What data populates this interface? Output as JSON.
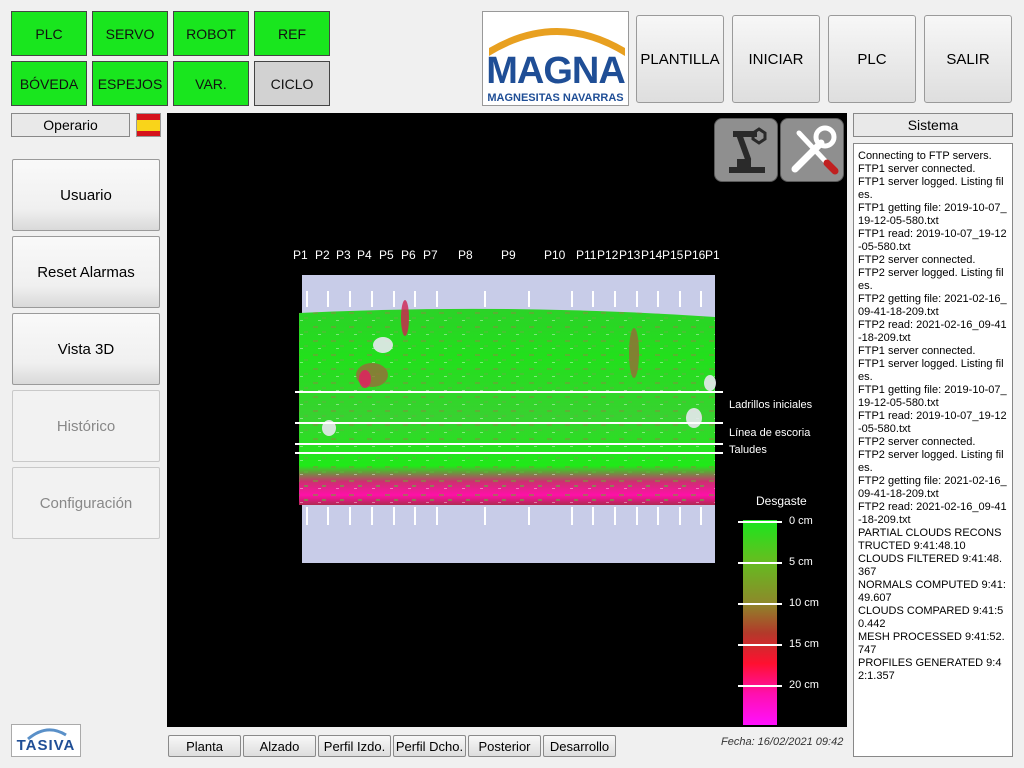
{
  "nav_buttons": {
    "plc": "PLC",
    "servo": "SERVO",
    "robot": "ROBOT",
    "ref": "REF",
    "boveda": "BÓVEDA",
    "espejos": "ESPEJOS",
    "var": "VAR.",
    "ciclo": "CICLO"
  },
  "logo": {
    "brand": "MAGNA",
    "subtitle": "MAGNESITAS NAVARRAS"
  },
  "top_buttons": {
    "plantilla": "PLANTILLA",
    "iniciar": "INICIAR",
    "plc": "PLC",
    "salir": "SALIR"
  },
  "user_label": "Operario",
  "sistema_label": "Sistema",
  "side_buttons": {
    "usuario": "Usuario",
    "reset_alarmas": "Reset Alarmas",
    "vista_3d": "Vista 3D",
    "historico": "Histórico",
    "configuracion": "Configuración"
  },
  "viewport": {
    "profiles": [
      "P1",
      "P2",
      "P3",
      "P4",
      "P5",
      "P6",
      "P7",
      "P8",
      "P9",
      "P10",
      "P11",
      "P12",
      "P13",
      "P14",
      "P15",
      "P16",
      "P1"
    ],
    "line_labels": {
      "ladrillos": "Ladrillos iniciales",
      "escoria": "Línea de escoria",
      "taludes": "Taludes"
    },
    "scale": {
      "title": "Desgaste",
      "ticks": [
        "0 cm",
        "5 cm",
        "10 cm",
        "15 cm",
        "20 cm"
      ]
    },
    "colors": {
      "good": "#19e61e",
      "mid": "#8c8a2a",
      "bad": "#ff1030",
      "worst": "#ff10ff"
    }
  },
  "log": [
    "Connecting to FTP servers.",
    "FTP1 server connected.",
    "FTP1 server logged. Listing files.",
    "FTP1 getting file: 2019-10-07_19-12-05-580.txt",
    "FTP1 read: 2019-10-07_19-12-05-580.txt",
    "FTP2 server connected.",
    "FTP2 server logged. Listing files.",
    "FTP2 getting file: 2021-02-16_09-41-18-209.txt",
    "FTP2 read: 2021-02-16_09-41-18-209.txt",
    "FTP1 server connected.",
    "FTP1 server logged. Listing files.",
    "FTP1 getting file: 2019-10-07_19-12-05-580.txt",
    "FTP1 read: 2019-10-07_19-12-05-580.txt",
    "FTP2 server connected.",
    "FTP2 server logged. Listing files.",
    "FTP2 getting file: 2021-02-16_09-41-18-209.txt",
    "FTP2 read: 2021-02-16_09-41-18-209.txt",
    "PARTIAL CLOUDS RECONSTRUCTED 9:41:48.10",
    "CLOUDS FILTERED 9:41:48.367",
    "NORMALS COMPUTED 9:41:49.607",
    "CLOUDS COMPARED 9:41:50.442",
    "MESH PROCESSED 9:41:52.747",
    "PROFILES GENERATED 9:42:1.357"
  ],
  "tabs": {
    "planta": "Planta",
    "alzado": "Alzado",
    "perfil_izdo": "Perfil Izdo.",
    "perfil_dcho": "Perfil Dcho.",
    "posterior": "Posterior",
    "desarrollo": "Desarrollo"
  },
  "date": "Fecha: 16/02/2021 09:42",
  "tasiva": "TASIVA"
}
